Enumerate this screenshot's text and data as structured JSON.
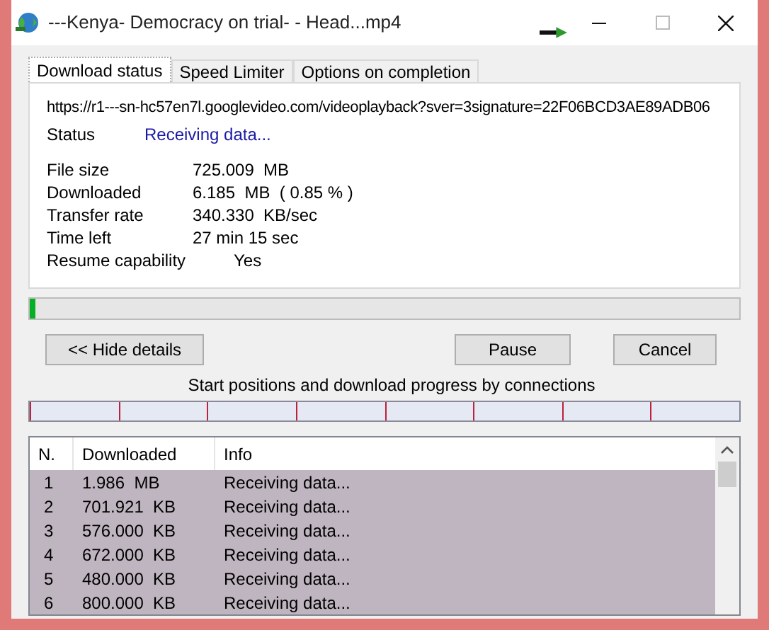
{
  "window": {
    "title": "---Kenya- Democracy on trial- - Head...mp4"
  },
  "tabs": [
    {
      "label": "Download status",
      "selected": true
    },
    {
      "label": "Speed Limiter",
      "selected": false
    },
    {
      "label": "Options on completion",
      "selected": false
    }
  ],
  "url": "https://r1---sn-hc57en7l.googlevideo.com/videoplayback?sver=3signature=22F06BCD3AE89ADB06",
  "status": {
    "label": "Status",
    "value": "Receiving data..."
  },
  "details": [
    {
      "label": "File size",
      "value": "725.009  MB"
    },
    {
      "label": "Downloaded",
      "value": "6.185  MB  ( 0.85 % )"
    },
    {
      "label": "Transfer rate",
      "value": "340.330  KB/sec"
    },
    {
      "label": "Time left",
      "value": "27 min 15 sec"
    },
    {
      "label": "Resume capability",
      "value": "Yes"
    }
  ],
  "progress": {
    "level": 0.0085
  },
  "buttons": {
    "hide_details": "<< Hide details",
    "pause": "Pause",
    "cancel": "Cancel"
  },
  "connections_label": "Start positions and download progress by connections",
  "table": {
    "columns": [
      "N.",
      "Downloaded",
      "Info"
    ],
    "rows": [
      {
        "cells": [
          "1",
          "1.986  MB",
          "Receiving data..."
        ],
        "selected": true
      },
      {
        "cells": [
          "2",
          "701.921  KB",
          "Receiving data..."
        ],
        "selected": true
      },
      {
        "cells": [
          "3",
          "576.000  KB",
          "Receiving data..."
        ],
        "selected": true
      },
      {
        "cells": [
          "4",
          "672.000  KB",
          "Receiving data..."
        ],
        "selected": true
      },
      {
        "cells": [
          "5",
          "480.000  KB",
          "Receiving data..."
        ],
        "selected": true
      },
      {
        "cells": [
          "6",
          "800.000  KB",
          "Receiving data..."
        ],
        "selected": true
      }
    ]
  }
}
